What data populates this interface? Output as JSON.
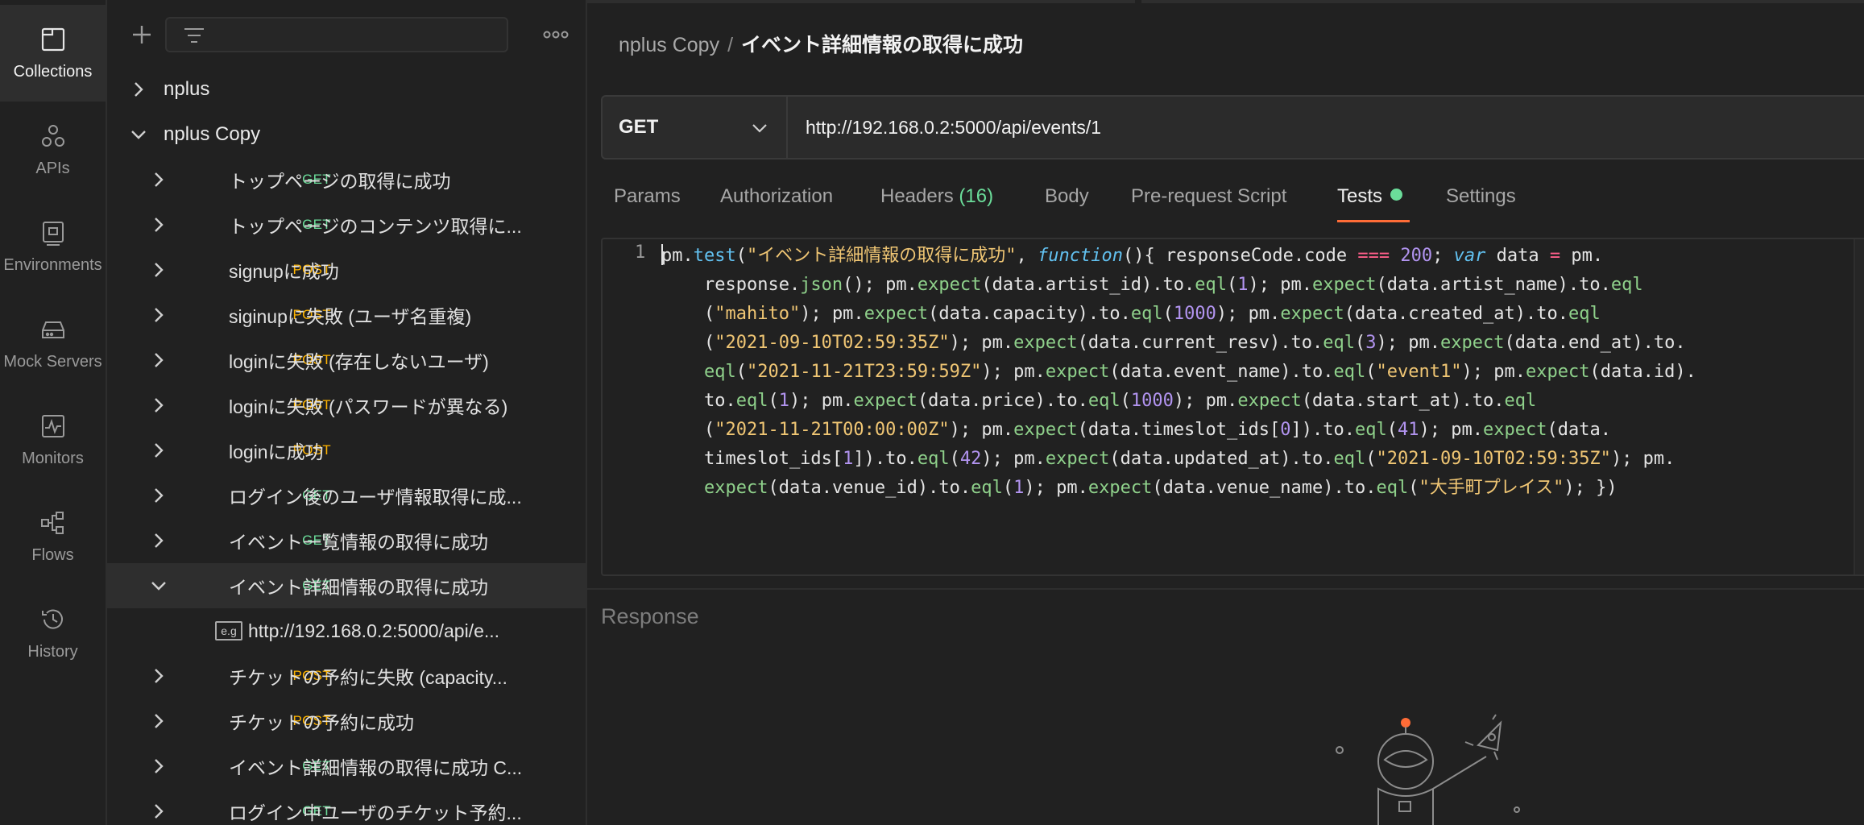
{
  "rail": {
    "items": [
      {
        "label": "Collections",
        "icon": "collections-icon",
        "active": true
      },
      {
        "label": "APIs",
        "icon": "apis-icon"
      },
      {
        "label": "Environments",
        "icon": "environments-icon"
      },
      {
        "label": "Mock Servers",
        "icon": "mock-servers-icon"
      },
      {
        "label": "Monitors",
        "icon": "monitors-icon"
      },
      {
        "label": "Flows",
        "icon": "flows-icon"
      },
      {
        "label": "History",
        "icon": "history-icon"
      }
    ]
  },
  "sidebar": {
    "collections": [
      {
        "name": "nplus",
        "expanded": false
      },
      {
        "name": "nplus Copy",
        "expanded": true
      }
    ],
    "requests": [
      {
        "method": "GET",
        "name": "トップページの取得に成功"
      },
      {
        "method": "GET",
        "name": "トップページのコンテンツ取得に..."
      },
      {
        "method": "POST",
        "name": "signupに成功"
      },
      {
        "method": "POST",
        "name": "siginupに失敗 (ユーザ名重複)"
      },
      {
        "method": "POST",
        "name": "loginに失敗 (存在しないユーザ)"
      },
      {
        "method": "POST",
        "name": "loginに失敗 (パスワードが異なる)"
      },
      {
        "method": "POST",
        "name": "loginに成功"
      },
      {
        "method": "GET",
        "name": "ログイン後のユーザ情報取得に成..."
      },
      {
        "method": "GET",
        "name": "イベント一覧情報の取得に成功"
      },
      {
        "method": "GET",
        "name": "イベント詳細情報の取得に成功"
      },
      {
        "method": "POST",
        "name": "チケットの予約に失敗 (capacity..."
      },
      {
        "method": "POST",
        "name": "チケットの予約に成功"
      },
      {
        "method": "GET",
        "name": "イベント詳細情報の取得に成功 C..."
      },
      {
        "method": "GET",
        "name": "ログイン中ユーザのチケット予約..."
      }
    ],
    "example": {
      "badge": "e.g",
      "name": "http://192.168.0.2:5000/api/e..."
    }
  },
  "breadcrumb": {
    "parent": "nplus Copy",
    "separator": "/",
    "current": "イベント詳細情報の取得に成功"
  },
  "request": {
    "method": "GET",
    "url": "http://192.168.0.2:5000/api/events/1"
  },
  "tabs": {
    "params": "Params",
    "authorization": "Authorization",
    "headers": "Headers",
    "headers_count": "(16)",
    "body": "Body",
    "prerequest": "Pre-request Script",
    "tests": "Tests",
    "settings": "Settings"
  },
  "editor": {
    "line_number": "1",
    "lines": [
      [
        [
          "t",
          "pm."
        ],
        [
          "f",
          "test"
        ],
        [
          "t",
          "("
        ],
        [
          "s",
          "\"イベント詳細情報の取得に成功\""
        ],
        [
          "t",
          ", "
        ],
        [
          "k",
          "function"
        ],
        [
          "t",
          "(){ responseCode.code "
        ],
        [
          "o",
          "==="
        ],
        [
          "t",
          " "
        ],
        [
          "n",
          "200"
        ],
        [
          "t",
          "; "
        ],
        [
          "k",
          "var"
        ],
        [
          "t",
          " data "
        ],
        [
          "o",
          "="
        ],
        [
          "t",
          " pm."
        ]
      ],
      [
        [
          "t",
          "    response."
        ],
        [
          "m",
          "json"
        ],
        [
          "t",
          "(); pm."
        ],
        [
          "m",
          "expect"
        ],
        [
          "t",
          "(data.artist_id).to."
        ],
        [
          "m",
          "eql"
        ],
        [
          "t",
          "("
        ],
        [
          "n",
          "1"
        ],
        [
          "t",
          "); pm."
        ],
        [
          "m",
          "expect"
        ],
        [
          "t",
          "(data.artist_name).to."
        ],
        [
          "m",
          "eql"
        ]
      ],
      [
        [
          "t",
          "    ("
        ],
        [
          "s",
          "\"mahito\""
        ],
        [
          "t",
          "); pm."
        ],
        [
          "m",
          "expect"
        ],
        [
          "t",
          "(data.capacity).to."
        ],
        [
          "m",
          "eql"
        ],
        [
          "t",
          "("
        ],
        [
          "n",
          "1000"
        ],
        [
          "t",
          "); pm."
        ],
        [
          "m",
          "expect"
        ],
        [
          "t",
          "(data.created_at).to."
        ],
        [
          "m",
          "eql"
        ]
      ],
      [
        [
          "t",
          "    ("
        ],
        [
          "s",
          "\"2021-09-10T02:59:35Z\""
        ],
        [
          "t",
          "); pm."
        ],
        [
          "m",
          "expect"
        ],
        [
          "t",
          "(data.current_resv).to."
        ],
        [
          "m",
          "eql"
        ],
        [
          "t",
          "("
        ],
        [
          "n",
          "3"
        ],
        [
          "t",
          "); pm."
        ],
        [
          "m",
          "expect"
        ],
        [
          "t",
          "(data.end_at).to."
        ]
      ],
      [
        [
          "t",
          "    "
        ],
        [
          "m",
          "eql"
        ],
        [
          "t",
          "("
        ],
        [
          "s",
          "\"2021-11-21T23:59:59Z\""
        ],
        [
          "t",
          "); pm."
        ],
        [
          "m",
          "expect"
        ],
        [
          "t",
          "(data.event_name).to."
        ],
        [
          "m",
          "eql"
        ],
        [
          "t",
          "("
        ],
        [
          "s",
          "\"event1\""
        ],
        [
          "t",
          "); pm."
        ],
        [
          "m",
          "expect"
        ],
        [
          "t",
          "(data.id)."
        ]
      ],
      [
        [
          "t",
          "    to."
        ],
        [
          "m",
          "eql"
        ],
        [
          "t",
          "("
        ],
        [
          "n",
          "1"
        ],
        [
          "t",
          "); pm."
        ],
        [
          "m",
          "expect"
        ],
        [
          "t",
          "(data.price).to."
        ],
        [
          "m",
          "eql"
        ],
        [
          "t",
          "("
        ],
        [
          "n",
          "1000"
        ],
        [
          "t",
          "); pm."
        ],
        [
          "m",
          "expect"
        ],
        [
          "t",
          "(data.start_at).to."
        ],
        [
          "m",
          "eql"
        ]
      ],
      [
        [
          "t",
          "    ("
        ],
        [
          "s",
          "\"2021-11-21T00:00:00Z\""
        ],
        [
          "t",
          "); pm."
        ],
        [
          "m",
          "expect"
        ],
        [
          "t",
          "(data.timeslot_ids["
        ],
        [
          "n",
          "0"
        ],
        [
          "t",
          "]).to."
        ],
        [
          "m",
          "eql"
        ],
        [
          "t",
          "("
        ],
        [
          "n",
          "41"
        ],
        [
          "t",
          "); pm."
        ],
        [
          "m",
          "expect"
        ],
        [
          "t",
          "(data."
        ]
      ],
      [
        [
          "t",
          "    timeslot_ids["
        ],
        [
          "n",
          "1"
        ],
        [
          "t",
          "]).to."
        ],
        [
          "m",
          "eql"
        ],
        [
          "t",
          "("
        ],
        [
          "n",
          "42"
        ],
        [
          "t",
          "); pm."
        ],
        [
          "m",
          "expect"
        ],
        [
          "t",
          "(data.updated_at).to."
        ],
        [
          "m",
          "eql"
        ],
        [
          "t",
          "("
        ],
        [
          "s",
          "\"2021-09-10T02:59:35Z\""
        ],
        [
          "t",
          "); pm."
        ]
      ],
      [
        [
          "t",
          "    "
        ],
        [
          "m",
          "expect"
        ],
        [
          "t",
          "(data.venue_id).to."
        ],
        [
          "m",
          "eql"
        ],
        [
          "t",
          "("
        ],
        [
          "n",
          "1"
        ],
        [
          "t",
          "); pm."
        ],
        [
          "m",
          "expect"
        ],
        [
          "t",
          "(data.venue_name).to."
        ],
        [
          "m",
          "eql"
        ],
        [
          "t",
          "("
        ],
        [
          "s",
          "\"大手町プレイス\""
        ],
        [
          "t",
          "); })"
        ]
      ]
    ]
  },
  "response": {
    "label": "Response"
  },
  "colors": {
    "get": "#6bdd9a",
    "post": "#ffb400",
    "accent": "#ff6c37"
  }
}
